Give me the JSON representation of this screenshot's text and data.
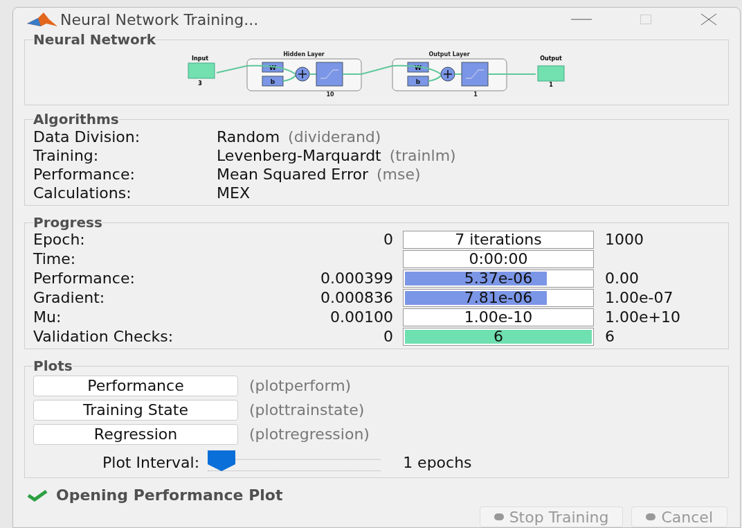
{
  "window": {
    "title": "Neural Network Training..."
  },
  "network": {
    "title": "Neural Network",
    "input": {
      "label": "Input",
      "size": "3"
    },
    "layers": [
      {
        "title": "Hidden Layer",
        "w": "W",
        "b": "b",
        "size": "10"
      },
      {
        "title": "Output Layer",
        "w": "W",
        "b": "b",
        "size": "1"
      }
    ],
    "output": {
      "label": "Output",
      "size": "1"
    }
  },
  "algorithms": {
    "title": "Algorithms",
    "rows": [
      {
        "label": "Data Division:",
        "value": "Random",
        "func": "(dividerand)"
      },
      {
        "label": "Training:",
        "value": "Levenberg-Marquardt",
        "func": "(trainlm)"
      },
      {
        "label": "Performance:",
        "value": "Mean Squared Error",
        "func": "(mse)"
      },
      {
        "label": "Calculations:",
        "value": "MEX"
      }
    ]
  },
  "progress": {
    "title": "Progress",
    "rows": [
      {
        "label": "Epoch:",
        "start": "0",
        "value": "7 iterations",
        "end": "1000"
      },
      {
        "label": "Time:",
        "value": "0:00:00"
      },
      {
        "label": "Performance:",
        "start": "0.000399",
        "value": "5.37e-06",
        "end": "0.00",
        "level": 0.76,
        "color": "#7b96e6"
      },
      {
        "label": "Gradient:",
        "start": "0.000836",
        "value": "7.81e-06",
        "end": "1.00e-07",
        "level": 0.76,
        "color": "#7b96e6"
      },
      {
        "label": "Mu:",
        "start": "0.00100",
        "value": "1.00e-10",
        "end": "1.00e+10"
      },
      {
        "label": "Validation Checks:",
        "start": "0",
        "value": "6",
        "end": "6",
        "level": 1,
        "color": "#6fe0b0"
      }
    ]
  },
  "plots": {
    "title": "Plots",
    "buttons": [
      {
        "label": "Performance",
        "func": "(plotperform)"
      },
      {
        "label": "Training State",
        "func": "(plottrainstate)"
      },
      {
        "label": "Regression",
        "func": "(plotregression)"
      }
    ],
    "interval": {
      "label": "Plot Interval:",
      "level": 0,
      "reading": "1 epochs"
    }
  },
  "status": "Opening Performance Plot",
  "buttons": [
    {
      "label": "Stop Training",
      "disabled": true
    },
    {
      "label": "Cancel",
      "disabled": true
    }
  ]
}
